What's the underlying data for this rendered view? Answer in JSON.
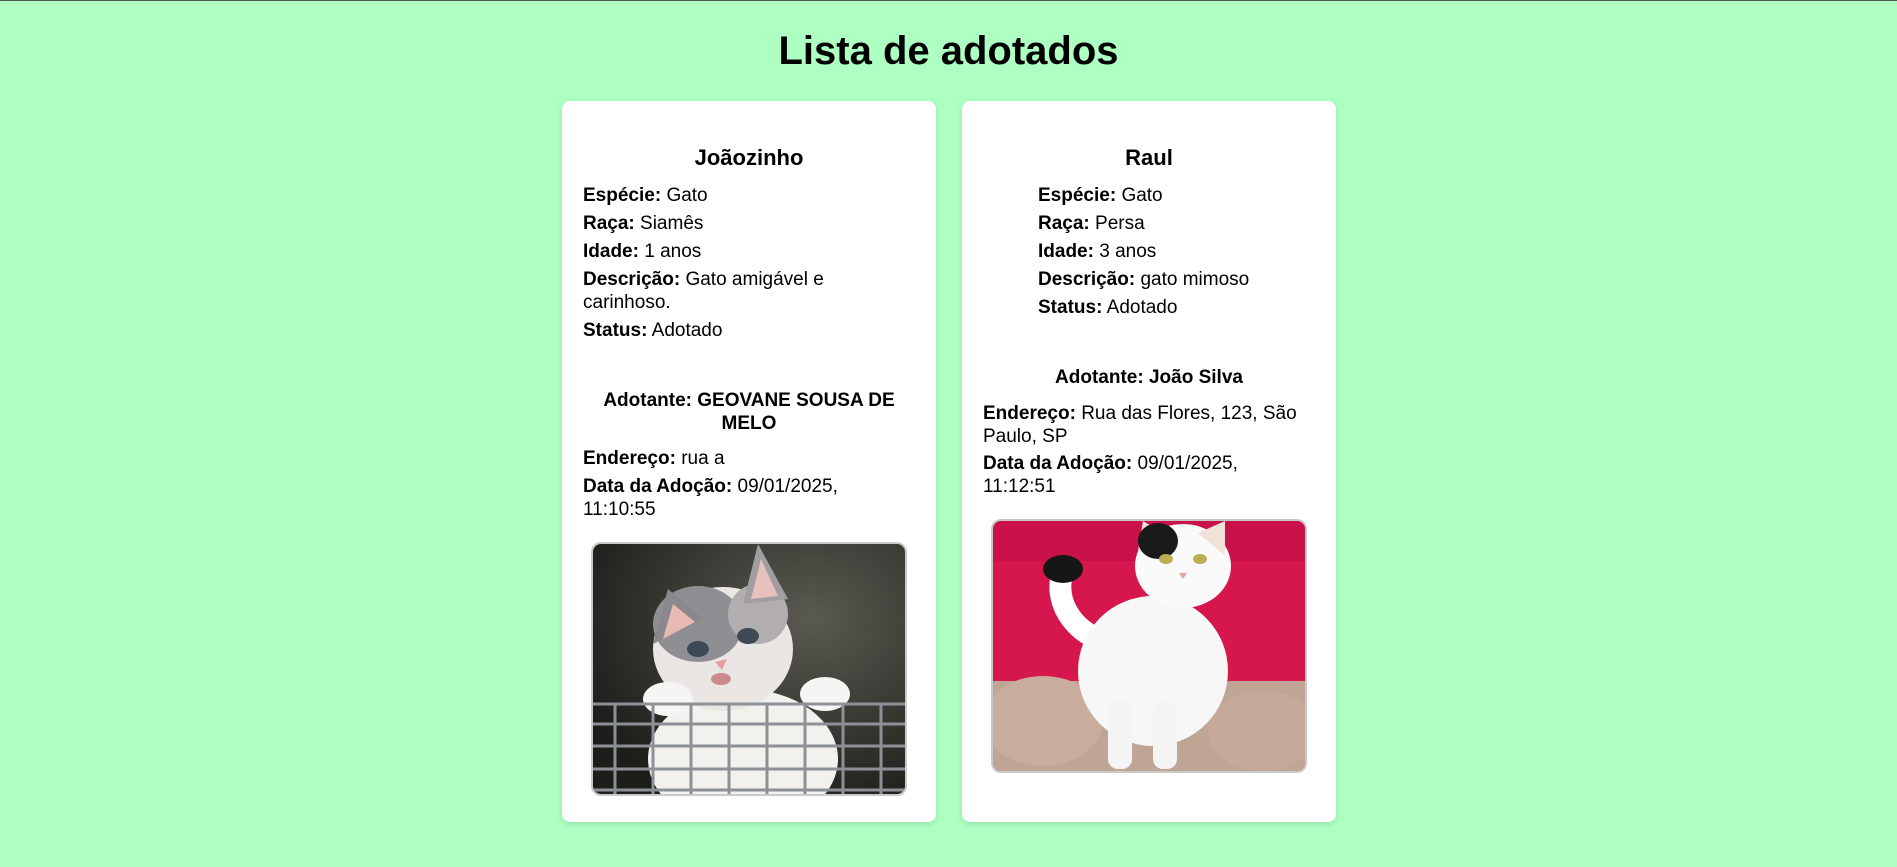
{
  "page": {
    "title": "Lista de adotados",
    "background_color": "#adffc2"
  },
  "labels": {
    "species": "Espécie:",
    "breed": "Raça:",
    "age": "Idade:",
    "description": "Descrição:",
    "status": "Status:",
    "adopter": "Adotante:",
    "address": "Endereço:",
    "adoption_date": "Data da Adoção:"
  },
  "adopted": [
    {
      "name": "Joãozinho",
      "species": "Gato",
      "breed": "Siamês",
      "age": "1 anos",
      "description": "Gato amigável e carinhoso.",
      "status": "Adotado",
      "adopter_name": "GEOVANE SOUSA DE MELO",
      "address": "rua a",
      "adoption_date": "09/01/2025, 11:10:55",
      "photo": "kitten-at-fence"
    },
    {
      "name": "Raul",
      "species": "Gato",
      "breed": "Persa",
      "age": "3 anos",
      "description": "gato mimoso",
      "status": "Adotado",
      "adopter_name": "João Silva",
      "address": "Rua das Flores, 123, São Paulo, SP",
      "adoption_date": "09/01/2025, 11:12:51",
      "photo": "white-cat-on-pink"
    }
  ]
}
